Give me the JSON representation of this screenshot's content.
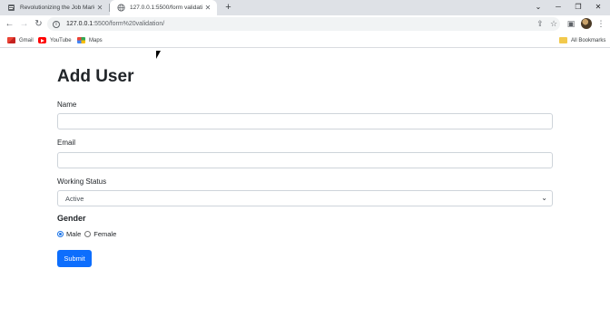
{
  "browser": {
    "tabs": [
      {
        "title": "Revolutionizing the Job Market |",
        "active": false,
        "favicon": "doc-icon"
      },
      {
        "title": "127.0.0.1:5500/form validation/",
        "active": true,
        "favicon": "globe-icon"
      }
    ],
    "new_tab": "+",
    "address": {
      "host": "127.0.0.1",
      "path": ":5500/form%20validation/"
    },
    "bookmarks": [
      "Gmail",
      "YouTube",
      "Maps"
    ],
    "all_bookmarks": "All Bookmarks"
  },
  "form": {
    "heading": "Add User",
    "name_label": "Name",
    "email_label": "Email",
    "status_label": "Working Status",
    "status_value": "Active",
    "gender_label": "Gender",
    "gender_options": [
      "Male",
      "Female"
    ],
    "gender_selected": "Male",
    "submit_label": "Submit"
  },
  "colors": {
    "primary": "#0d6efd",
    "text": "#212529",
    "border": "#ced4da"
  }
}
